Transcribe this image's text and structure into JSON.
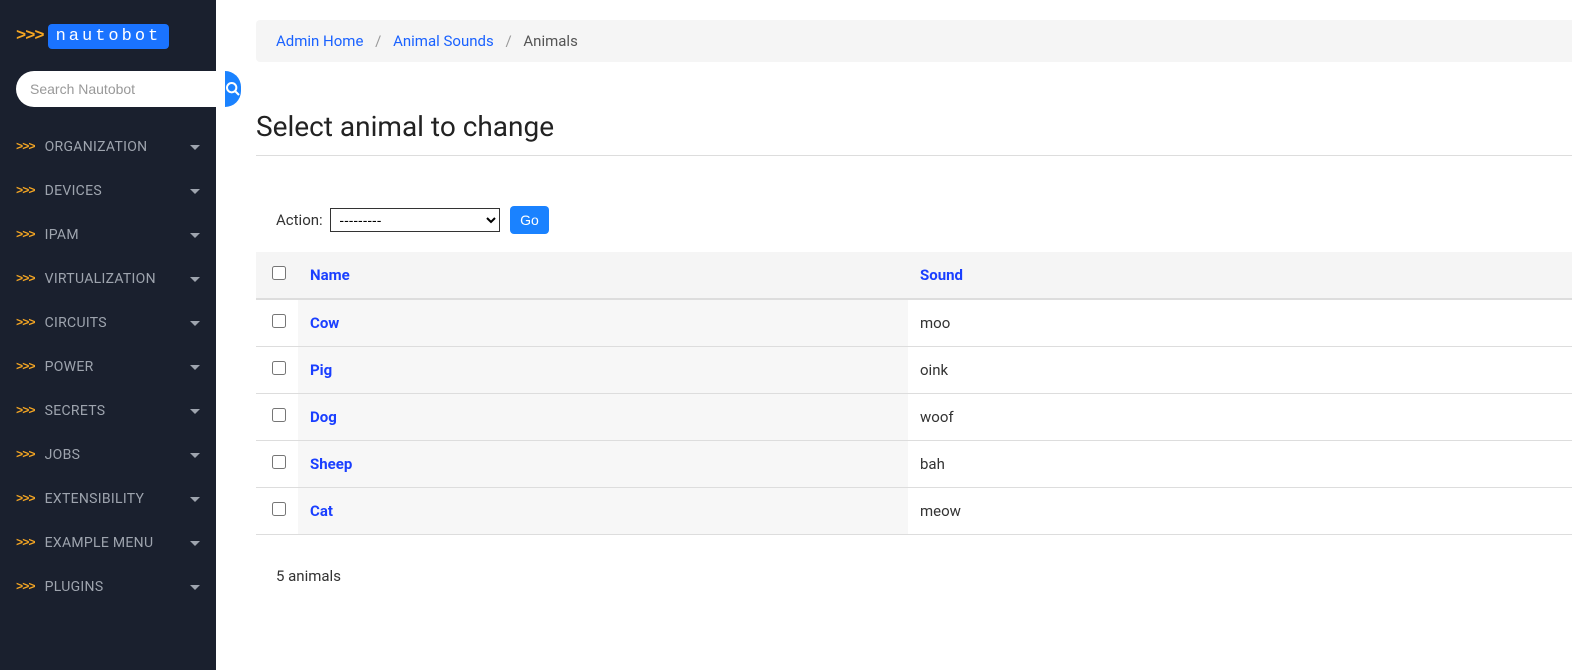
{
  "brand": {
    "arrows": ">>>",
    "name": "nautobot"
  },
  "search": {
    "placeholder": "Search Nautobot"
  },
  "nav": [
    {
      "label": "ORGANIZATION"
    },
    {
      "label": "DEVICES"
    },
    {
      "label": "IPAM"
    },
    {
      "label": "VIRTUALIZATION"
    },
    {
      "label": "CIRCUITS"
    },
    {
      "label": "POWER"
    },
    {
      "label": "SECRETS"
    },
    {
      "label": "JOBS"
    },
    {
      "label": "EXTENSIBILITY"
    },
    {
      "label": "EXAMPLE MENU"
    },
    {
      "label": "PLUGINS"
    }
  ],
  "breadcrumb": {
    "home": "Admin Home",
    "section": "Animal Sounds",
    "current": "Animals"
  },
  "page_title": "Select animal to change",
  "action": {
    "label": "Action:",
    "selected": "---------",
    "go": "Go"
  },
  "columns": {
    "name": "Name",
    "sound": "Sound"
  },
  "rows": [
    {
      "name": "Cow",
      "sound": "moo"
    },
    {
      "name": "Pig",
      "sound": "oink"
    },
    {
      "name": "Dog",
      "sound": "woof"
    },
    {
      "name": "Sheep",
      "sound": "bah"
    },
    {
      "name": "Cat",
      "sound": "meow"
    }
  ],
  "count_text": "5 animals"
}
